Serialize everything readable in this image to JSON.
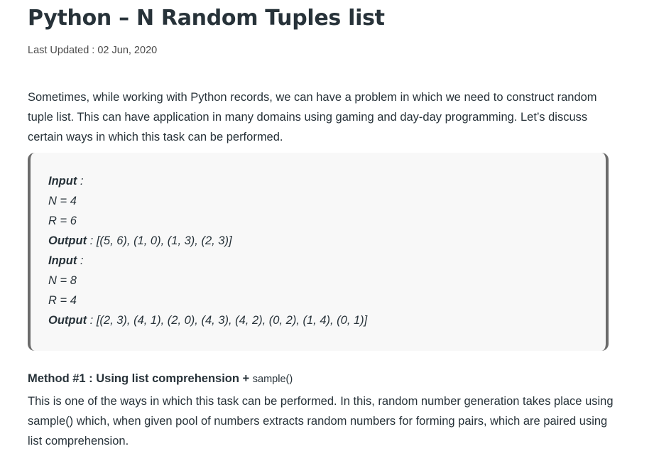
{
  "article": {
    "title": "Python – N Random Tuples list",
    "last_updated": "Last Updated : 02 Jun, 2020",
    "intro": "Sometimes, while working with Python records, we can have a problem in which we need to construct random tuple list. This can have application in many domains using gaming and day-day programming. Let’s discuss certain ways in which this task can be performed."
  },
  "example": {
    "lines": [
      {
        "label": "Input",
        "sep": " :",
        "value": ""
      },
      {
        "label": "",
        "sep": "",
        "value": "N = 4"
      },
      {
        "label": "",
        "sep": "",
        "value": "R = 6"
      },
      {
        "label": "Output",
        "sep": " : ",
        "value": "[(5, 6), (1, 0), (1, 3), (2, 3)]"
      },
      {
        "label": "Input",
        "sep": " :",
        "value": ""
      },
      {
        "label": "",
        "sep": "",
        "value": "N = 8"
      },
      {
        "label": "",
        "sep": "",
        "value": "R = 4"
      },
      {
        "label": "Output",
        "sep": " : ",
        "value": "[(2, 3), (4, 1), (2, 0), (4, 3), (4, 2), (0, 2), (1, 4), (0, 1)]"
      }
    ]
  },
  "method1": {
    "heading": "Method #1 : Using list comprehension + ",
    "heading_code": "sample()",
    "body": "This is one of the ways in which this task can be performed. In this, random number generation takes place using sample() which, when given pool of numbers extracts random numbers for forming pairs, which are paired using list comprehension."
  }
}
